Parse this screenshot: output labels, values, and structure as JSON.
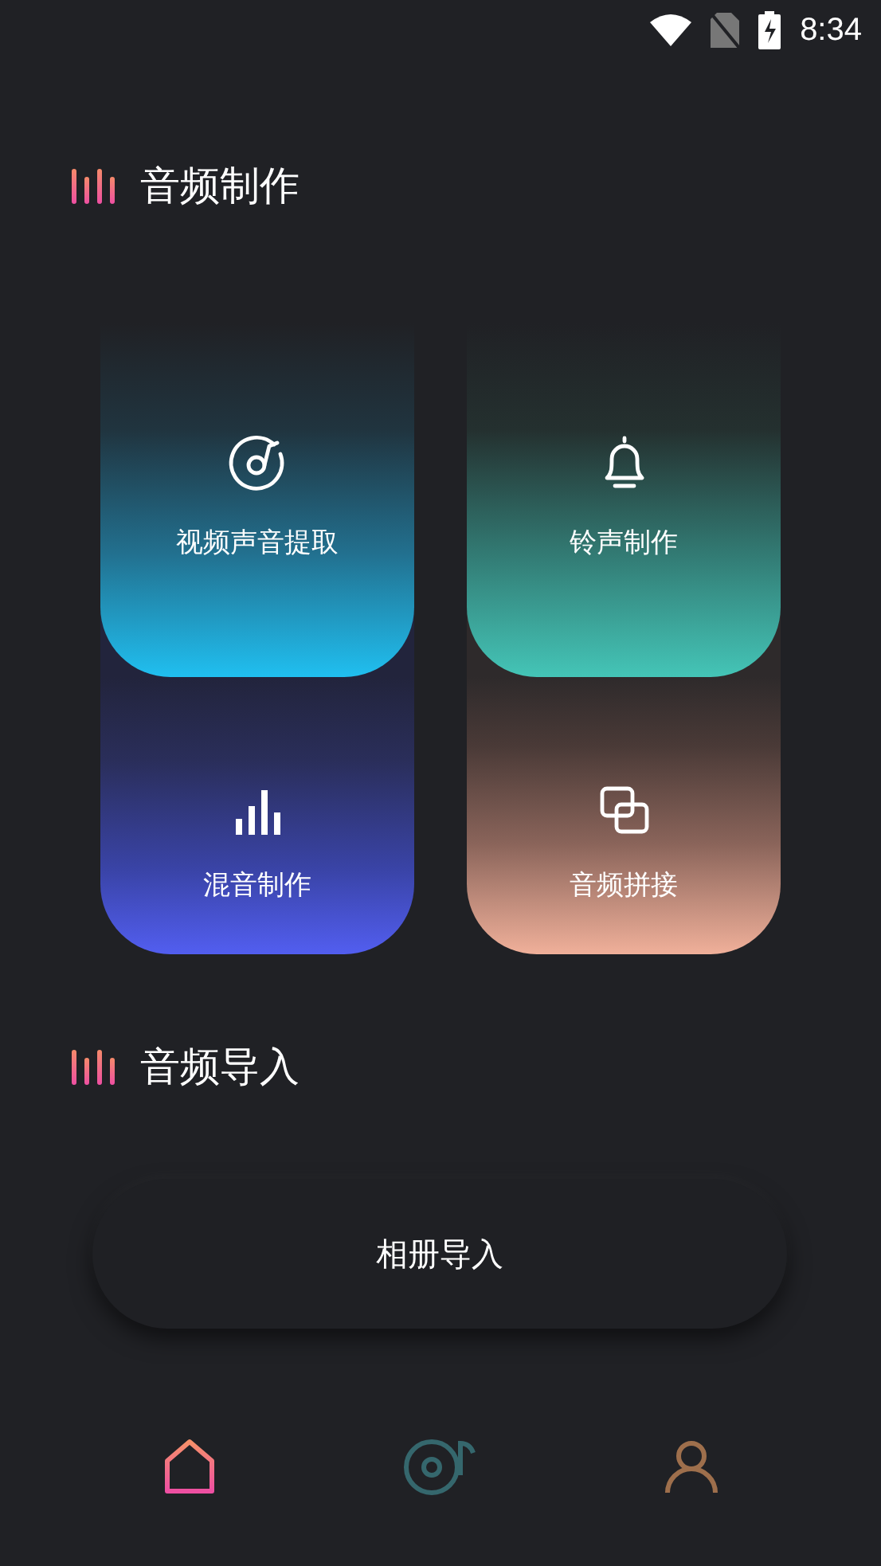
{
  "status_bar": {
    "time": "8:34"
  },
  "sections": [
    {
      "title": "音频制作",
      "tools": [
        {
          "kind": "extract",
          "label": "视频声音提取"
        },
        {
          "kind": "ringtone",
          "label": "铃声制作"
        },
        {
          "kind": "mix",
          "label": "混音制作"
        },
        {
          "kind": "splice",
          "label": "音频拼接"
        }
      ]
    },
    {
      "title": "音频导入",
      "button": "相册导入"
    }
  ],
  "nav": [
    {
      "kind": "home",
      "selected": true
    },
    {
      "kind": "disc",
      "selected": false
    },
    {
      "kind": "person",
      "selected": false
    }
  ]
}
